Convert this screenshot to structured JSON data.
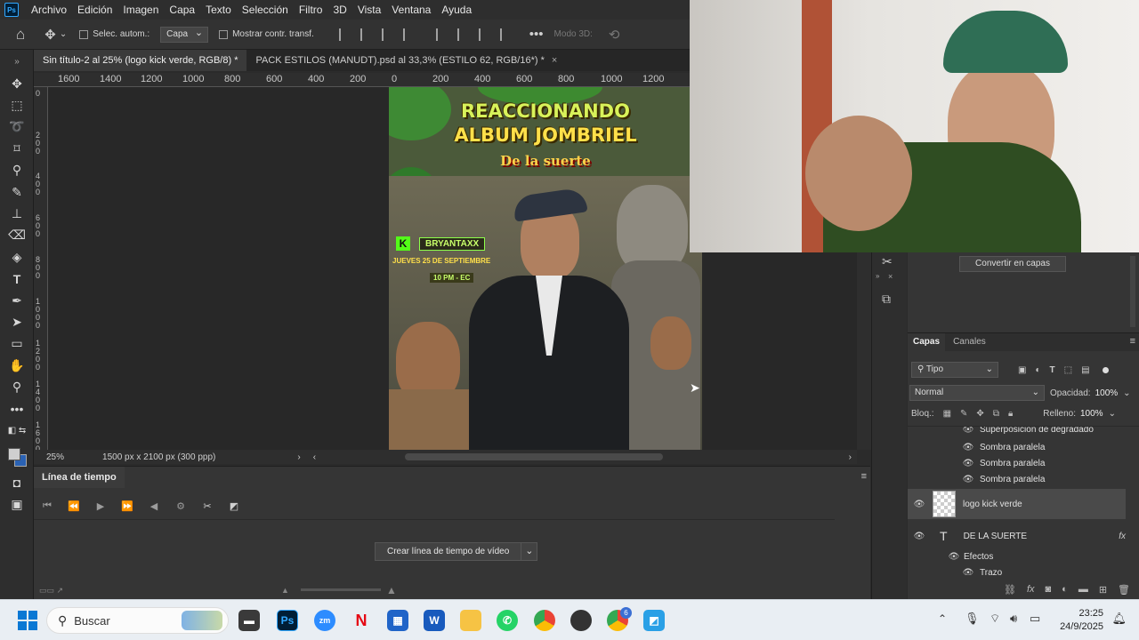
{
  "menubar": {
    "logo": "Ps",
    "items": [
      "Archivo",
      "Edición",
      "Imagen",
      "Capa",
      "Texto",
      "Selección",
      "Filtro",
      "3D",
      "Vista",
      "Ventana",
      "Ayuda"
    ]
  },
  "options": {
    "auto_select_label": "Selec. autom.:",
    "auto_select_target": "Capa",
    "transform_controls_label": "Mostrar contr. transf.",
    "mode3d_label": "Modo 3D:"
  },
  "tabs": [
    {
      "label": "Sin título-2 al 25% (logo kick verde, RGB/8) *",
      "active": true
    },
    {
      "label": "PACK ESTILOS (MANUDT).psd al 33,3% (ESTILO 62, RGB/16*) *",
      "active": false
    }
  ],
  "ruler": {
    "h_labels": [
      "1600",
      "1400",
      "1200",
      "1000",
      "800",
      "600",
      "400",
      "200",
      "0",
      "200",
      "400",
      "600",
      "800",
      "1000",
      "1200"
    ],
    "v_labels": [
      "0",
      "2\n0\n0",
      "4\n0\n0",
      "6\n0\n0",
      "8\n0\n0",
      "1\n0\n0\n0",
      "1\n2\n0\n0",
      "1\n4\n0\n0",
      "1\n6\n0\n0"
    ]
  },
  "artwork": {
    "line1": "REACCIONANDO",
    "line2": "ALBUM JOMBRIEL",
    "line3": "De la suerte",
    "kick_letter": "K",
    "channel": "BRYANTAXX",
    "date": "JUEVES 25 DE SEPTIEMBRE",
    "time": "10 PM - EC"
  },
  "status": {
    "zoom": "25%",
    "doc_size": "1500 px x 2100 px (300 ppp)"
  },
  "timeline": {
    "tab_label": "Línea de tiempo",
    "create_label": "Crear línea de tiempo de vídeo"
  },
  "properties": {
    "convert_label": "Convertir en capas"
  },
  "layers": {
    "tabs": [
      "Capas",
      "Canales"
    ],
    "filter_kind": "Tipo",
    "blend_mode": "Normal",
    "opacity_label": "Opacidad:",
    "opacity_value": "100%",
    "lock_label": "Bloq.:",
    "fill_label": "Relleno:",
    "fill_value": "100%",
    "effects_partial": "Superposición de degradado",
    "effect_rows": [
      "Sombra paralela",
      "Sombra paralela",
      "Sombra paralela"
    ],
    "selected_layer": "logo kick verde",
    "text_layer": "DE LA SUERTE",
    "effects_label": "Efectos",
    "stroke_label": "Trazo"
  },
  "taskbar": {
    "search_placeholder": "Buscar",
    "time": "23:25",
    "date": "24/9/2025",
    "badge_count": "6"
  },
  "colors": {
    "accent_blue": "#31a8ff",
    "panel_bg": "#353535",
    "taskbar_bg": "#e9eef3"
  }
}
